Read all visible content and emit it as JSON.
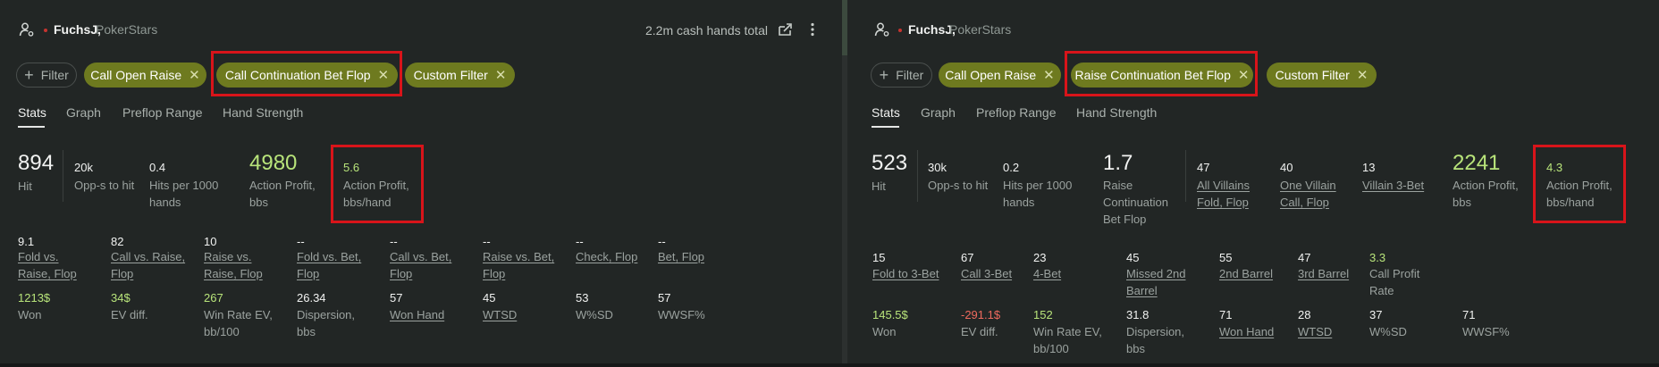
{
  "left": {
    "username": "FuchsJ,",
    "site": "PokerStars",
    "total": "2.2m cash hands total",
    "add_filter": "Filter",
    "chips": [
      "Call Open Raise",
      "Call Continuation Bet Flop",
      "Custom Filter"
    ],
    "tabs": [
      "Stats",
      "Graph",
      "Preflop Range",
      "Hand Strength"
    ],
    "stats": [
      {
        "value": "894",
        "label": "Hit"
      },
      {
        "value": "20k",
        "label": "Opp-s to hit"
      },
      {
        "value": "0.4",
        "label": "Hits per 1000\nhands"
      },
      {
        "value": "4980",
        "label": "Action Profit,\nbbs"
      },
      {
        "value": "5.6",
        "label": "Action Profit,\nbbs/hand"
      }
    ],
    "row2": [
      {
        "value": "9.1",
        "label": "Fold vs.\nRaise, Flop"
      },
      {
        "value": "82",
        "label": "Call vs. Raise,\nFlop"
      },
      {
        "value": "10",
        "label": "Raise vs.\nRaise, Flop"
      },
      {
        "value": "--",
        "label": "Fold vs. Bet,\nFlop"
      },
      {
        "value": "--",
        "label": "Call vs. Bet,\nFlop"
      },
      {
        "value": "--",
        "label": "Raise vs. Bet,\nFlop"
      },
      {
        "value": "--",
        "label": "Check, Flop"
      },
      {
        "value": "--",
        "label": "Bet, Flop"
      }
    ],
    "row3": [
      {
        "value": "1213$",
        "label": "Won"
      },
      {
        "value": "34$",
        "label": "EV diff."
      },
      {
        "value": "267",
        "label": "Win Rate EV,\nbb/100"
      },
      {
        "value": "26.34",
        "label": "Dispersion,\nbbs"
      },
      {
        "value": "57",
        "label": "Won Hand"
      },
      {
        "value": "45",
        "label": "WTSD"
      },
      {
        "value": "53",
        "label": "W%SD"
      },
      {
        "value": "57",
        "label": "WWSF%"
      }
    ]
  },
  "right": {
    "username": "FuchsJ,",
    "site": "PokerStars",
    "add_filter": "Filter",
    "chips": [
      "Call Open Raise",
      "Raise Continuation Bet Flop",
      "Custom Filter"
    ],
    "tabs": [
      "Stats",
      "Graph",
      "Preflop Range",
      "Hand Strength"
    ],
    "stats": [
      {
        "value": "523",
        "label": "Hit"
      },
      {
        "value": "30k",
        "label": "Opp-s to hit"
      },
      {
        "value": "0.2",
        "label": "Hits per 1000\nhands"
      },
      {
        "value": "1.7",
        "label": "Raise\nContinuation\nBet Flop"
      },
      {
        "value": "47",
        "label": "All Villains\nFold, Flop"
      },
      {
        "value": "40",
        "label": "One Villain\nCall, Flop"
      },
      {
        "value": "13",
        "label": "Villain 3-Bet"
      },
      {
        "value": "2241",
        "label": "Action Profit,\nbbs"
      },
      {
        "value": "4.3",
        "label": "Action Profit,\nbbs/hand"
      }
    ],
    "row2": [
      {
        "value": "15",
        "label": "Fold to 3-Bet"
      },
      {
        "value": "67",
        "label": "Call 3-Bet"
      },
      {
        "value": "23",
        "label": "4-Bet"
      },
      {
        "value": "45",
        "label": "Missed 2nd\nBarrel"
      },
      {
        "value": "55",
        "label": "2nd Barrel"
      },
      {
        "value": "47",
        "label": "3rd Barrel"
      },
      {
        "value": "3.3",
        "label": "Call Profit\nRate"
      }
    ],
    "row3": [
      {
        "value": "145.5$",
        "label": "Won"
      },
      {
        "value": "-291.1$",
        "label": "EV diff."
      },
      {
        "value": "152",
        "label": "Win Rate EV,\nbb/100"
      },
      {
        "value": "31.8",
        "label": "Dispersion,\nbbs"
      },
      {
        "value": "71",
        "label": "Won Hand"
      },
      {
        "value": "28",
        "label": "WTSD"
      },
      {
        "value": "37",
        "label": "W%SD"
      },
      {
        "value": "71",
        "label": "WWSF%"
      }
    ]
  },
  "icons": {
    "user": "user-settings-icon",
    "share": "share-icon",
    "more": "more-vertical-icon",
    "plus": "plus-icon",
    "remove": "close-icon"
  },
  "colors": {
    "chip_green": "#6e7a1f",
    "highlight_red": "#d8141a",
    "positive_value": "#b8e47a",
    "negative_value": "#ef6a5e",
    "status_dot": "#c6342f"
  }
}
